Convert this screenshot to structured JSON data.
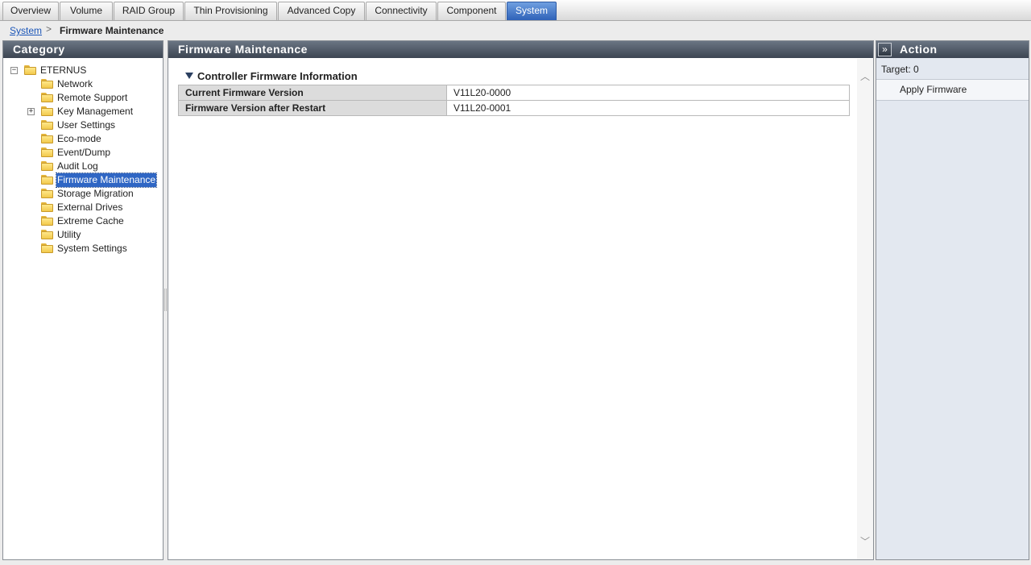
{
  "tabs": [
    {
      "label": "Overview",
      "active": false
    },
    {
      "label": "Volume",
      "active": false
    },
    {
      "label": "RAID Group",
      "active": false
    },
    {
      "label": "Thin Provisioning",
      "active": false
    },
    {
      "label": "Advanced Copy",
      "active": false
    },
    {
      "label": "Connectivity",
      "active": false
    },
    {
      "label": "Component",
      "active": false
    },
    {
      "label": "System",
      "active": true
    }
  ],
  "breadcrumb": {
    "root": "System",
    "separator": ">",
    "current": "Firmware Maintenance"
  },
  "category": {
    "title": "Category",
    "root": {
      "label": "ETERNUS",
      "expander": "−"
    },
    "items": [
      {
        "label": "Network"
      },
      {
        "label": "Remote Support"
      },
      {
        "label": "Key Management",
        "expander": "+"
      },
      {
        "label": "User Settings"
      },
      {
        "label": "Eco-mode"
      },
      {
        "label": "Event/Dump"
      },
      {
        "label": "Audit Log"
      },
      {
        "label": "Firmware Maintenance",
        "selected": true
      },
      {
        "label": "Storage Migration"
      },
      {
        "label": "External Drives"
      },
      {
        "label": "Extreme Cache"
      },
      {
        "label": "Utility"
      },
      {
        "label": "System Settings"
      }
    ]
  },
  "main": {
    "title": "Firmware Maintenance",
    "section": {
      "title": "Controller Firmware Information",
      "rows": [
        {
          "label": "Current Firmware Version",
          "value": "V11L20-0000"
        },
        {
          "label": "Firmware Version after Restart",
          "value": "V11L20-0001"
        }
      ]
    },
    "scroll_up": "︿",
    "scroll_down": "﹀"
  },
  "action": {
    "title": "Action",
    "collapse_glyph": "»",
    "target": "Target:  0",
    "items": [
      {
        "label": "Apply Firmware"
      }
    ]
  },
  "colors": {
    "active_tab": "#2f62b8",
    "panel_header": "#3c4552",
    "selection": "#2f66c4",
    "link": "#1a55b8"
  }
}
